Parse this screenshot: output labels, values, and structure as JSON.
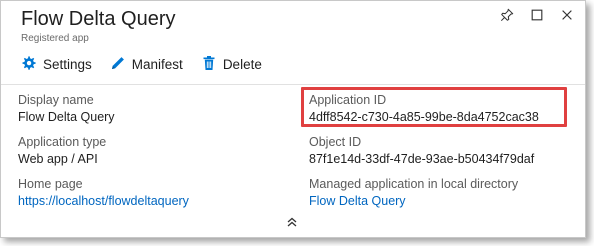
{
  "header": {
    "title": "Flow Delta Query",
    "subtitle": "Registered app"
  },
  "toolbar": {
    "settings_label": "Settings",
    "manifest_label": "Manifest",
    "delete_label": "Delete"
  },
  "fields": {
    "display_name": {
      "label": "Display name",
      "value": "Flow Delta Query"
    },
    "application_id": {
      "label": "Application ID",
      "value": "4dff8542-c730-4a85-99be-8da4752cac38"
    },
    "application_type": {
      "label": "Application type",
      "value": "Web app / API"
    },
    "object_id": {
      "label": "Object ID",
      "value": "87f1e14d-33df-47de-93ae-b50434f79daf"
    },
    "home_page": {
      "label": "Home page",
      "value": "https://localhost/flowdeltaquery"
    },
    "managed_app": {
      "label": "Managed application in local directory",
      "value": "Flow Delta Query"
    }
  },
  "colors": {
    "link": "#0066c0",
    "accent": "#0078d4",
    "highlight_border": "#e04040"
  },
  "icons": {
    "settings": "gear-icon",
    "manifest": "pencil-icon",
    "delete": "trash-icon",
    "pin": "pin-icon",
    "maximize": "maximize-icon",
    "close": "close-icon",
    "collapse": "double-chevron-up-icon"
  }
}
